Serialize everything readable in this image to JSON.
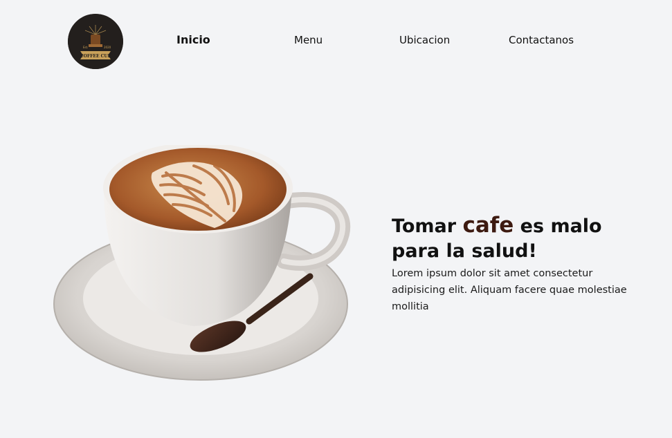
{
  "logo": {
    "alt": "COFFEE CUP",
    "year_left": "Est.",
    "year_right": "2020",
    "icon": "coffee-cup-logo-icon"
  },
  "nav": {
    "items": [
      {
        "label": "Inicio",
        "active": true
      },
      {
        "label": "Menu",
        "active": false
      },
      {
        "label": "Ubicacion",
        "active": false
      },
      {
        "label": "Contactanos",
        "active": false
      }
    ]
  },
  "hero": {
    "title_before": "Tomar ",
    "title_accent": "cafe",
    "title_after": " es malo para la salud!",
    "description": "Lorem ipsum dolor sit amet consectetur adipisicing elit. Aliquam facere quae molestiae mollitia",
    "image_icon": "latte-cup-image"
  },
  "colors": {
    "background": "#f3f4f6",
    "accent": "#3d1a10",
    "logo_bg": "#231f1d"
  }
}
